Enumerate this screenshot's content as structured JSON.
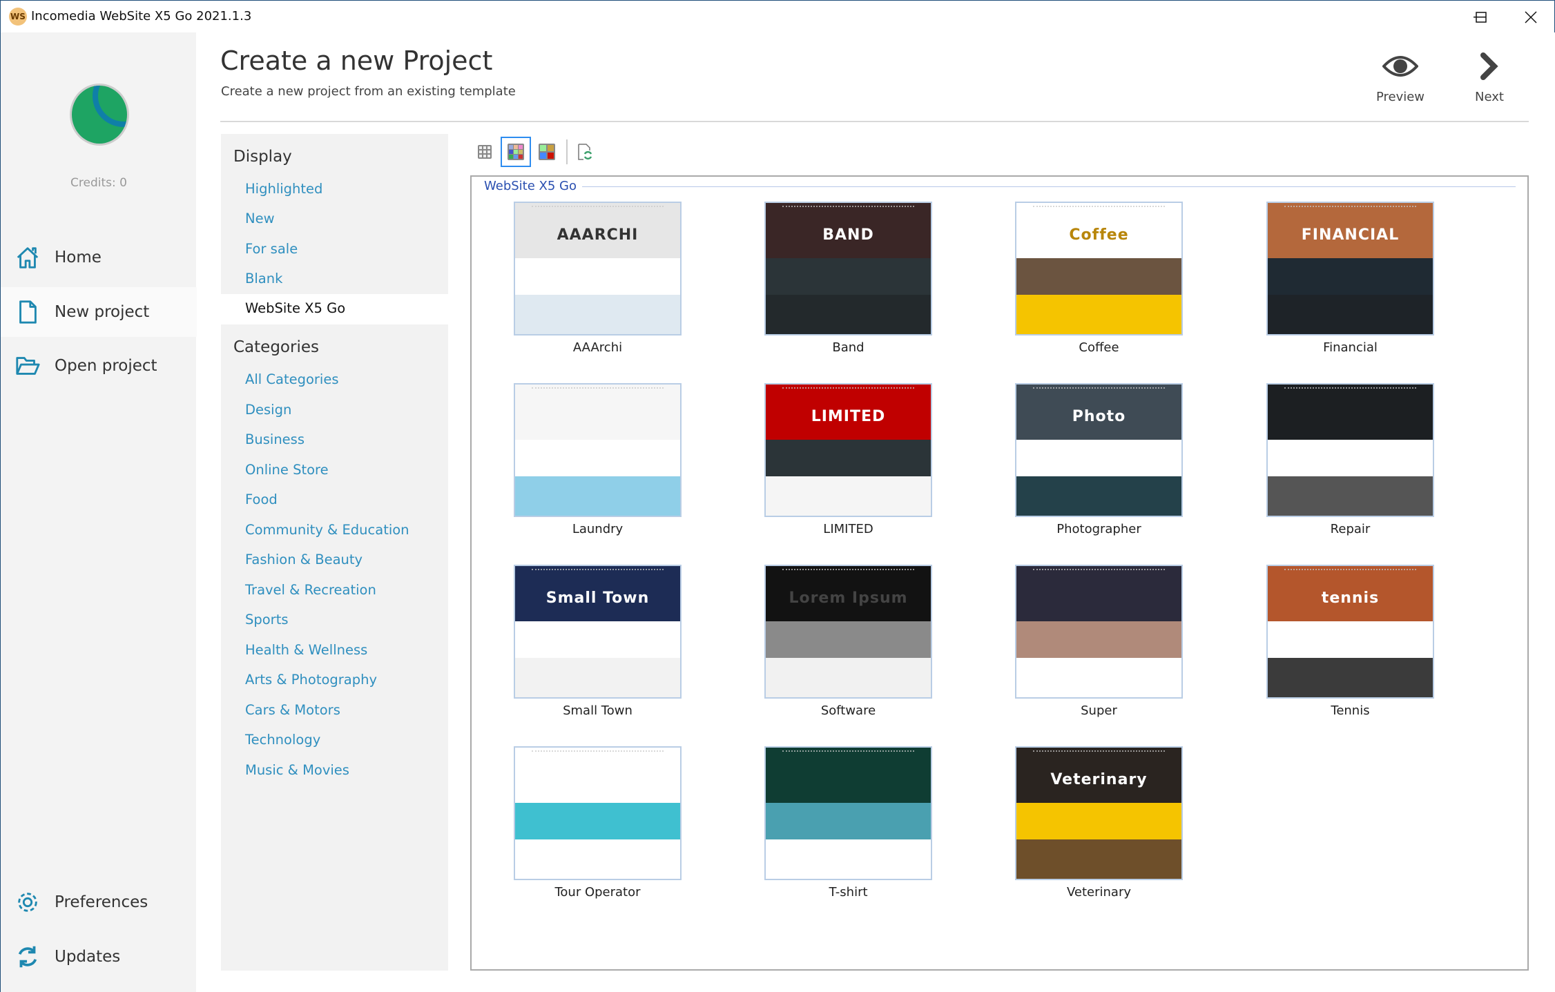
{
  "window": {
    "title": "Incomedia WebSite X5 Go 2021.1.3",
    "app_icon_text": "WS",
    "controls": [
      "minimize",
      "maximize",
      "close"
    ]
  },
  "sidebar": {
    "credits": "Credits: 0",
    "nav": [
      {
        "label": "Home",
        "icon": "home-icon"
      },
      {
        "label": "New project",
        "icon": "file-icon",
        "active": true
      },
      {
        "label": "Open project",
        "icon": "folder-open-icon"
      }
    ],
    "bottom": [
      {
        "label": "Preferences",
        "icon": "gear-icon"
      },
      {
        "label": "Updates",
        "icon": "refresh-icon"
      }
    ]
  },
  "header": {
    "title": "Create a new Project",
    "subtitle": "Create a new project from an existing template",
    "preview": "Preview",
    "next": "Next"
  },
  "filters": {
    "display_heading": "Display",
    "display": [
      "Highlighted",
      "New",
      "For sale",
      "Blank",
      "WebSite X5 Go"
    ],
    "selected": "WebSite X5 Go",
    "categories_heading": "Categories",
    "categories": [
      "All Categories",
      "Design",
      "Business",
      "Online Store",
      "Food",
      "Community & Education",
      "Fashion & Beauty",
      "Travel & Recreation",
      "Sports",
      "Health & Wellness",
      "Arts & Photography",
      "Cars & Motors",
      "Technology",
      "Music & Movies"
    ]
  },
  "toolbar": {
    "views": [
      "small-grid-view",
      "medium-grid-view",
      "large-grid-view"
    ],
    "active_view": "medium-grid-view",
    "refresh": "refresh-templates"
  },
  "gallery": {
    "group_title": "WebSite X5 Go",
    "templates": [
      {
        "name": "AAArchi",
        "hero": "AAARCHI",
        "hero_color": "#333333",
        "colors": [
          "#e6e6e6",
          "#ffffff",
          "#dfe9f1"
        ]
      },
      {
        "name": "Band",
        "hero": "BAND",
        "hero_color": "#ffffff",
        "colors": [
          "#3a2626",
          "#2b3438",
          "#23292c"
        ]
      },
      {
        "name": "Coffee",
        "hero": "Coffee",
        "hero_color": "#b8860b",
        "colors": [
          "#ffffff",
          "#6b5440",
          "#f5c400"
        ]
      },
      {
        "name": "Financial",
        "hero": "FINANCIAL",
        "hero_color": "#ffffff",
        "colors": [
          "#b4683c",
          "#1f2a33",
          "#1e2328"
        ]
      },
      {
        "name": "Laundry",
        "hero": "",
        "hero_color": "#e04040",
        "colors": [
          "#f6f6f6",
          "#ffffff",
          "#8fcfe8"
        ]
      },
      {
        "name": "LIMITED",
        "hero": "LIMITED",
        "hero_color": "#ffffff",
        "colors": [
          "#c00000",
          "#2b3438",
          "#f5f5f5"
        ]
      },
      {
        "name": "Photographer",
        "hero": "Photo",
        "hero_color": "#ffffff",
        "colors": [
          "#3f4b55",
          "#ffffff",
          "#24414a"
        ]
      },
      {
        "name": "Repair",
        "hero": "",
        "hero_color": "#ffffff",
        "colors": [
          "#1c1f22",
          "#ffffff",
          "#555555"
        ]
      },
      {
        "name": "Small Town",
        "hero": "Small Town",
        "hero_color": "#ffffff",
        "colors": [
          "#1d2c55",
          "#ffffff",
          "#f2f2f2"
        ]
      },
      {
        "name": "Software",
        "hero": "Lorem Ipsum",
        "hero_color": "#444444",
        "colors": [
          "#121212",
          "#8a8a8a",
          "#f1f1f1"
        ]
      },
      {
        "name": "Super",
        "hero": "",
        "hero_color": "#ffffff",
        "colors": [
          "#2b2a3b",
          "#b08a7a",
          "#ffffff"
        ]
      },
      {
        "name": "Tennis",
        "hero": "tennis",
        "hero_color": "#ffffff",
        "colors": [
          "#b4562c",
          "#ffffff",
          "#3b3b3b"
        ]
      },
      {
        "name": "Tour Operator",
        "hero": "",
        "hero_color": "#ffffff",
        "colors": [
          "#ffffff",
          "#3fc0d0",
          "#ffffff"
        ]
      },
      {
        "name": "T-shirt",
        "hero": "",
        "hero_color": "#ffffff",
        "colors": [
          "#0f3d33",
          "#4aa0b0",
          "#ffffff"
        ]
      },
      {
        "name": "Veterinary",
        "hero": "Veterinary",
        "hero_color": "#ffffff",
        "colors": [
          "#2a2420",
          "#f5c400",
          "#6e4f2a"
        ]
      }
    ]
  },
  "colors": {
    "accent": "#2f8fbf",
    "icon": "#1e88b0",
    "selection": "#2d8cf0",
    "group_title": "#2a4fb0"
  }
}
